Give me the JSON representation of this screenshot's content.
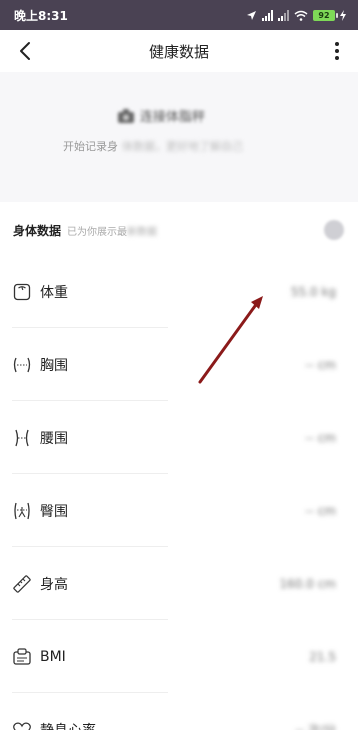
{
  "status_bar": {
    "time": "晚上8:31",
    "battery": "92"
  },
  "nav": {
    "title": "健康数据"
  },
  "hero": {
    "camera_text": "连接体脂秤",
    "subtitle_start": "开始记录身",
    "subtitle_rest": "体数据，更好地了解自己"
  },
  "section": {
    "title": "身体数据",
    "hint_start": "已为你展示最",
    "hint_rest": "新数据"
  },
  "rows": [
    {
      "label": "体重",
      "value": "55.0 kg",
      "icon": "scale-icon"
    },
    {
      "label": "胸围",
      "value": "-- cm",
      "icon": "chest-icon"
    },
    {
      "label": "腰围",
      "value": "-- cm",
      "icon": "waist-icon"
    },
    {
      "label": "臀围",
      "value": "-- cm",
      "icon": "hip-icon"
    },
    {
      "label": "身高",
      "value": "160.0 cm",
      "icon": "ruler-icon"
    },
    {
      "label": "BMI",
      "value": "21.5",
      "icon": "bmi-icon"
    },
    {
      "label": "静息心率",
      "value": "-- 次/分",
      "icon": "heart-rate-icon"
    }
  ],
  "colors": {
    "status_bar_bg": "#4a4253",
    "arrow": "#8b1a1a",
    "battery": "#7ed957"
  }
}
